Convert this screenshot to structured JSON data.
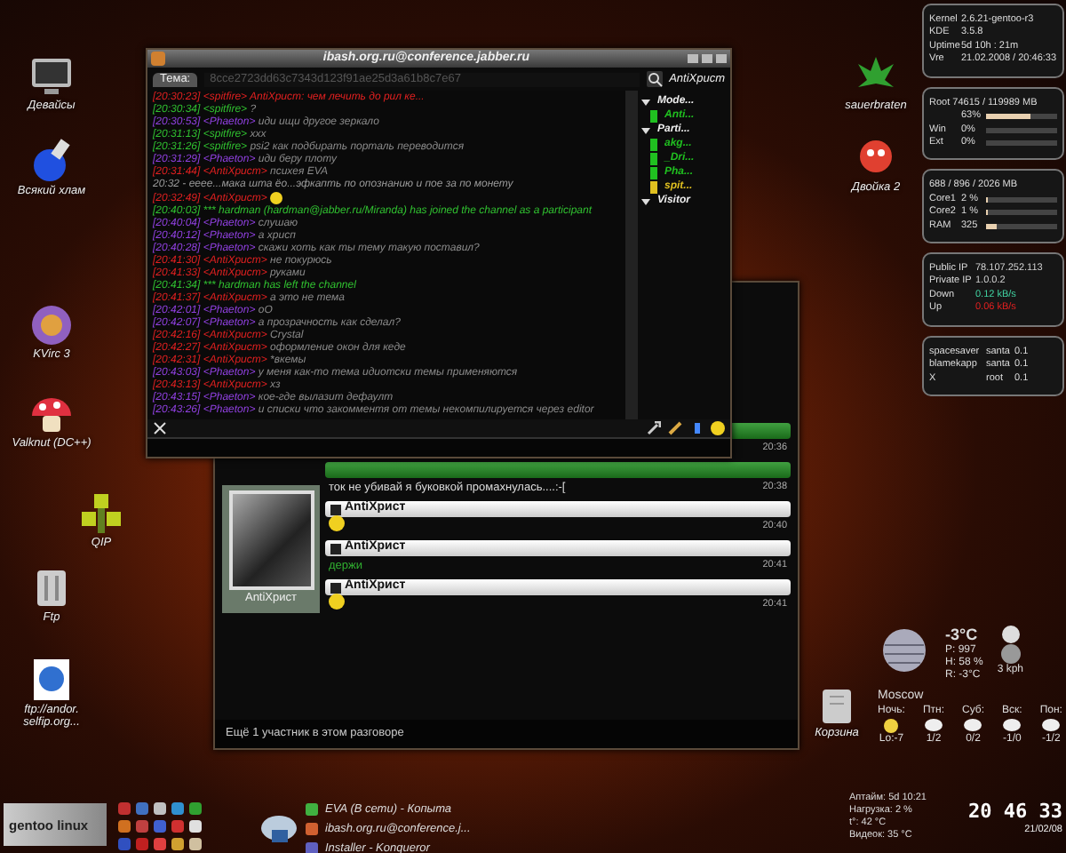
{
  "desktop_icons_left": [
    {
      "label": "Девайсы"
    },
    {
      "label": "Всякий хлам"
    },
    {
      "label": "KVirc 3"
    },
    {
      "label": "Valknut (DC++)"
    },
    {
      "label": "QIP"
    },
    {
      "label": "Ftp"
    },
    {
      "label": "ftp://andor. selfip.org..."
    }
  ],
  "desktop_icons_right": [
    {
      "label": "sauerbraten"
    },
    {
      "label": "Двойка 2"
    }
  ],
  "trash": {
    "label": "Корзина"
  },
  "monitors": [
    {
      "kind": "table",
      "rows": [
        {
          "label": "Kernel",
          "value": "2.6.21-gentoo-r3"
        },
        {
          "label": "KDE",
          "value": "3.5.8"
        },
        {
          "label": "Uptime",
          "value": "5d  10h : 21m"
        },
        {
          "label": "Vre",
          "value": "21.02.2008 / 20:46:33"
        }
      ]
    },
    {
      "kind": "bars",
      "header": "Root  74615 / 119989 MB",
      "rows": [
        {
          "value": "63%",
          "level": 0.63
        },
        {
          "label": "Win",
          "value": "0%",
          "level": 0
        },
        {
          "label": "Ext",
          "value": "0%",
          "level": 0
        }
      ]
    },
    {
      "kind": "bars",
      "header": "688  /  896 / 2026 MB",
      "rows": [
        {
          "label": "Core1",
          "value": "2 %",
          "level": 0.02
        },
        {
          "label": "Core2",
          "value": "1 %",
          "level": 0.01
        },
        {
          "label": "RAM",
          "value": "325",
          "level": 0.16
        }
      ]
    },
    {
      "kind": "net",
      "rows": [
        {
          "label": "Public IP",
          "value": "78.107.252.113",
          "color": "#d0d0d0"
        },
        {
          "label": "Private IP",
          "value": "1.0.0.2",
          "color": "#d0d0d0"
        },
        {
          "label": "Down",
          "value": "0.12 kB/s",
          "color": "#40d0a0"
        },
        {
          "label": "Up",
          "value": "0.06 kB/s",
          "color": "#e02020"
        }
      ]
    },
    {
      "kind": "procs",
      "rows": [
        {
          "label": "spacesaver",
          "user": "santa",
          "value": "0.1"
        },
        {
          "label": "blamekapp",
          "user": "santa",
          "value": "0.1"
        },
        {
          "label": "X",
          "user": "root",
          "value": "0.1"
        }
      ]
    }
  ],
  "weather": {
    "temperature": "-3°C",
    "pressure": "P: 997",
    "humidity": "H: 58 %",
    "realfeel": "R: -3°C",
    "wind": "3 kph",
    "city": "Moscow",
    "days": [
      {
        "day": "Ночь:",
        "temps": "Lo:-7"
      },
      {
        "day": "Птн:",
        "temps": "1/2"
      },
      {
        "day": "Суб:",
        "temps": "0/2"
      },
      {
        "day": "Вск:",
        "temps": "-1/0"
      },
      {
        "day": "Пон:",
        "temps": "-1/2"
      }
    ]
  },
  "system_info": [
    "Аптайм: 5d 10:21",
    "Нагрузка: 2 %",
    "t°: 42 °C",
    "Видеок: 35 °C"
  ],
  "clock": {
    "time": "20 46 33",
    "date": "21/02/08"
  },
  "taskbar": {
    "logo": "gentoo linux",
    "tasks": [
      "EVA (В сети) - Копыта",
      "ibash.org.ru@conference.j...",
      "Installer - Konqueror"
    ]
  },
  "groupchat": {
    "title": "ibash.org.ru@conference.jabber.ru",
    "topic_label": "Тема:",
    "topic": "8cce2723dd63c7343d123f91ae25d3a61b8c7e67",
    "user": "AntiXрист",
    "roster": [
      {
        "group": "Mode...",
        "expanded": true,
        "children": [
          {
            "nick": "Anti...",
            "color": "#20c020"
          }
        ]
      },
      {
        "group": "Parti...",
        "expanded": true,
        "children": [
          {
            "nick": "akg...",
            "color": "#20c020"
          },
          {
            "nick": "_Dri...",
            "color": "#20c020"
          },
          {
            "nick": "Pha...",
            "color": "#20c020"
          },
          {
            "nick": "spit...",
            "color": "#e0c020"
          }
        ]
      },
      {
        "group": "Visitor",
        "expanded": true
      }
    ],
    "messages": [
      {
        "kind": "message",
        "time": "[20:30:23]",
        "nick": "<spitfire>",
        "text": "AntiXрист: чем лечить до рил ке...",
        "color": "#e02020",
        "highlighted": true
      },
      {
        "kind": "message",
        "time": "[20:30:34]",
        "nick": "<spitfire>",
        "text": "?",
        "color": "#30c030",
        "highlighted": false
      },
      {
        "kind": "message",
        "time": "[20:30:53]",
        "nick": "<Phaeton>",
        "text": "иди ищи другое зеркало",
        "color": "#9040e0",
        "highlighted": false
      },
      {
        "kind": "message",
        "time": "[20:31:13]",
        "nick": "<spitfire>",
        "text": "ххх",
        "color": "#30c030",
        "highlighted": false
      },
      {
        "kind": "message",
        "time": "[20:31:26]",
        "nick": "<spitfire>",
        "text": "psi2 как подбирать порталь переводится",
        "color": "#30c030",
        "highlighted": false
      },
      {
        "kind": "message",
        "time": "[20:31:29]",
        "nick": "<Phaeton>",
        "text": "иди беру плоту",
        "color": "#9040e0",
        "highlighted": false
      },
      {
        "kind": "message",
        "time": "[20:31:44]",
        "nick": "<AntiXрист>",
        "text": "психея EVA",
        "color": "#e02020",
        "highlighted": false
      },
      {
        "kind": "plain",
        "text": "20:32 - ееее...мака шта ёо...эфкапть по опознанию и пое за по монету",
        "color": "#9a9a9a"
      },
      {
        "kind": "emoticon",
        "time": "[20:32:49]",
        "nick": "<AntiXрист>",
        "color": "#e02020"
      },
      {
        "kind": "event",
        "text": "[20:40:03] *** hardman (hardman@jabber.ru/Miranda) has joined the channel as a participant",
        "color": "#30c030"
      },
      {
        "kind": "message",
        "time": "[20:40:04]",
        "nick": "<Phaeton>",
        "text": "слушаю",
        "color": "#9040e0",
        "highlighted": false
      },
      {
        "kind": "message",
        "time": "[20:40:12]",
        "nick": "<Phaeton>",
        "text": "а хрисп",
        "color": "#9040e0",
        "highlighted": false
      },
      {
        "kind": "message",
        "time": "[20:40:28]",
        "nick": "<Phaeton>",
        "text": "скажи хоть как ты тему такую поставил?",
        "color": "#9040e0",
        "highlighted": false
      },
      {
        "kind": "message",
        "time": "[20:41:30]",
        "nick": "<AntiXрист>",
        "text": "не покурюсь",
        "color": "#e02020",
        "highlighted": false
      },
      {
        "kind": "message",
        "time": "[20:41:33]",
        "nick": "<AntiXрист>",
        "text": "руками",
        "color": "#e02020",
        "highlighted": false
      },
      {
        "kind": "event",
        "text": "[20:41:34] *** hardman has left the channel",
        "color": "#30c030"
      },
      {
        "kind": "message",
        "time": "[20:41:37]",
        "nick": "<AntiXрист>",
        "text": "а это не тема",
        "color": "#e02020",
        "highlighted": false
      },
      {
        "kind": "message",
        "time": "[20:42:01]",
        "nick": "<Phaeton>",
        "text": "оО",
        "color": "#9040e0",
        "highlighted": false
      },
      {
        "kind": "message",
        "time": "[20:42:07]",
        "nick": "<Phaeton>",
        "text": "а прозрачность как сделал?",
        "color": "#9040e0",
        "highlighted": false
      },
      {
        "kind": "message",
        "time": "[20:42:16]",
        "nick": "<AntiXрист>",
        "text": "Crystal",
        "color": "#e02020",
        "highlighted": false
      },
      {
        "kind": "message",
        "time": "[20:42:27]",
        "nick": "<AntiXрист>",
        "text": "оформление окон для кеде",
        "color": "#e02020",
        "highlighted": false
      },
      {
        "kind": "message",
        "time": "[20:42:31]",
        "nick": "<AntiXрист>",
        "text": "*вкемы",
        "color": "#e02020",
        "highlighted": false
      },
      {
        "kind": "message",
        "time": "[20:43:03]",
        "nick": "<Phaeton>",
        "text": "у меня как-то тема идиотски темы применяются",
        "color": "#9040e0",
        "highlighted": false
      },
      {
        "kind": "message",
        "time": "[20:43:13]",
        "nick": "<AntiXрист>",
        "text": "хз",
        "color": "#e02020",
        "highlighted": false
      },
      {
        "kind": "message",
        "time": "[20:43:15]",
        "nick": "<Phaeton>",
        "text": "кое-где вылазит дефаулт",
        "color": "#9040e0",
        "highlighted": false
      },
      {
        "kind": "message",
        "time": "[20:43:26]",
        "nick": "<Phaeton>",
        "text": "и списки что закомментя от темы некомпилируется через editor",
        "color": "#9040e0",
        "highlighted": false
      }
    ]
  },
  "chat_window": {
    "avatar_name": "AntiXрист",
    "entries": [
      {
        "kind": "other",
        "smiley": false,
        "time": "20:36"
      },
      {
        "kind": "other",
        "text": "ток не убивай я буковкой промахнулась....:-[",
        "smiley": false,
        "time": "20:38"
      },
      {
        "kind": "own",
        "nick": "AntiXрист",
        "smiley": true,
        "time": "20:40"
      },
      {
        "kind": "own",
        "nick": "AntiXрист",
        "text": "держи",
        "smiley": false,
        "time": "20:41"
      },
      {
        "kind": "own",
        "nick": "AntiXрист",
        "smiley": true,
        "time": "20:41"
      }
    ],
    "footer": "Ещё 1 участник в этом разговоре"
  }
}
